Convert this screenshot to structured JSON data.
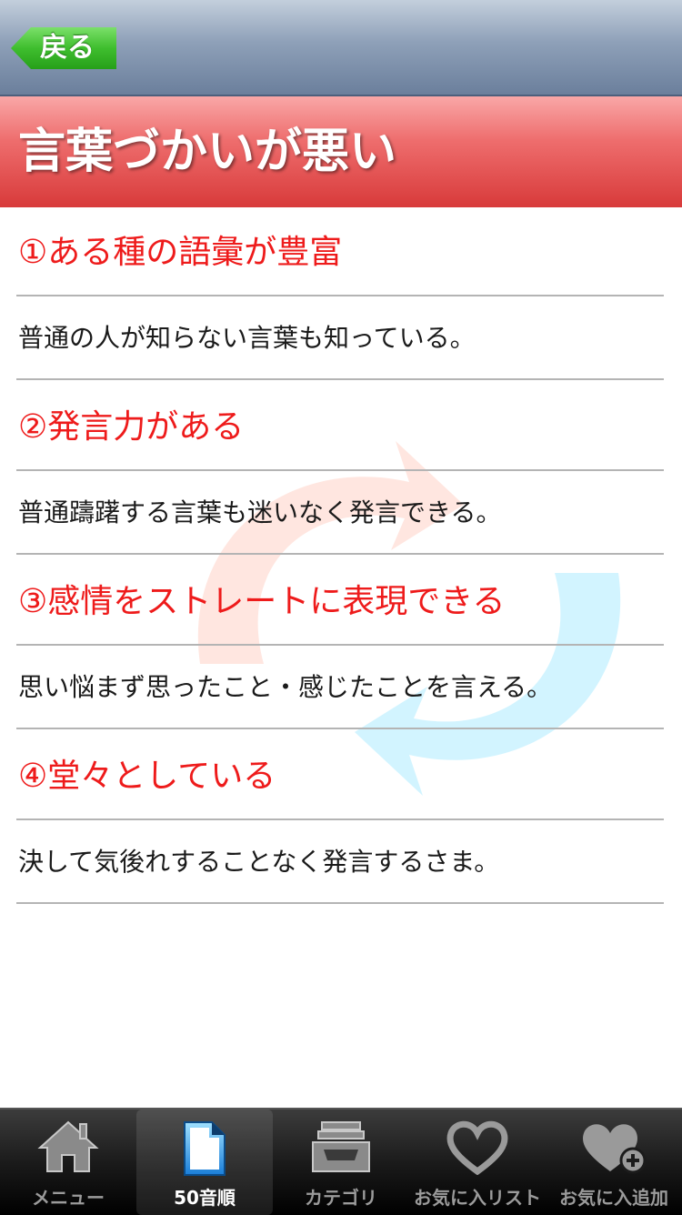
{
  "nav": {
    "back_label": "戻る"
  },
  "title": "言葉づかいが悪い",
  "items": [
    {
      "heading": "①ある種の語彙が豊富",
      "body": "普通の人が知らない言葉も知っている。"
    },
    {
      "heading": "②発言力がある",
      "body": "普通躊躇する言葉も迷いなく発言できる。"
    },
    {
      "heading": "③感情をストレートに表現できる",
      "body": "思い悩まず思ったこと・感じたことを言える。"
    },
    {
      "heading": "④堂々としている",
      "body": "決して気後れすることなく発言するさま。"
    }
  ],
  "tabs": [
    {
      "label": "メニュー",
      "icon": "home-icon"
    },
    {
      "label": "50音順",
      "icon": "document-icon",
      "active": true
    },
    {
      "label": "カテゴリ",
      "icon": "inbox-icon"
    },
    {
      "label": "お気に入リスト",
      "icon": "heart-icon"
    },
    {
      "label": "お気に入追加",
      "icon": "heart-add-icon"
    }
  ],
  "colors": {
    "heading": "#ee1b1b",
    "title_band": "#e04848",
    "back_button": "#3fbe2e"
  }
}
